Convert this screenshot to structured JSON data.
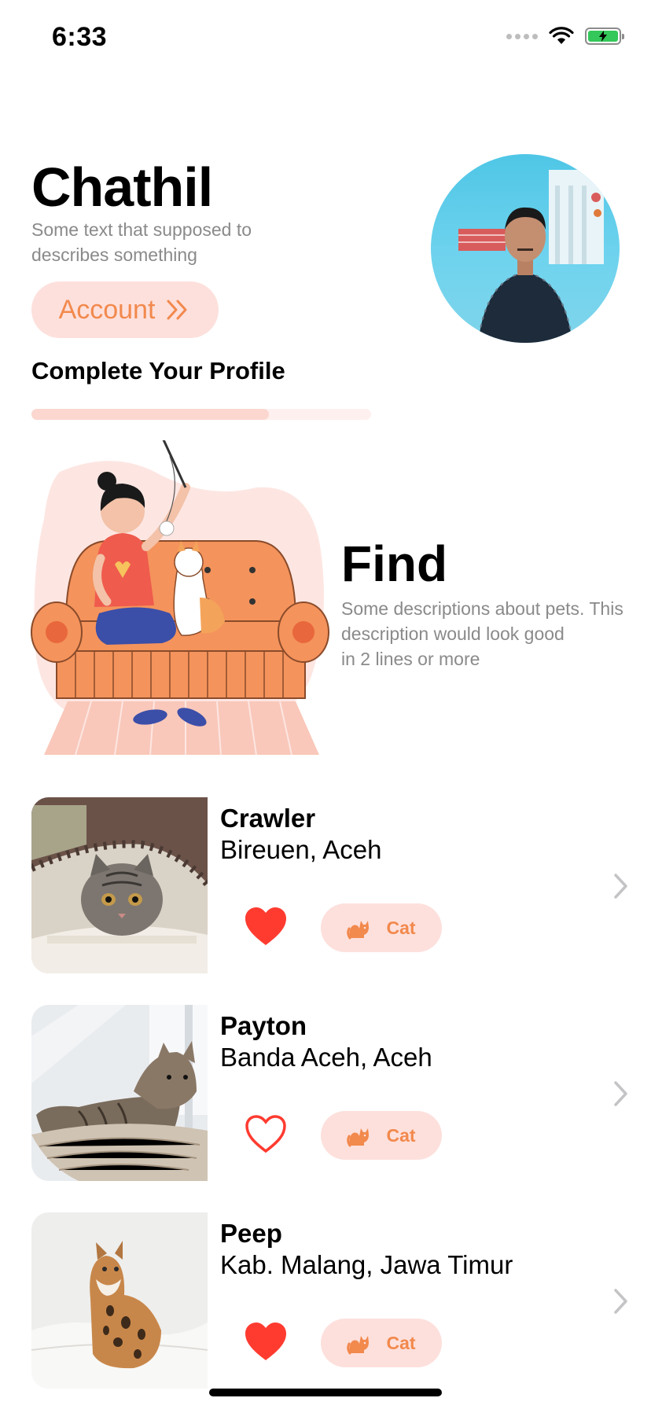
{
  "status_bar": {
    "time": "6:33"
  },
  "header": {
    "name": "Chathil",
    "subtitle": "Some text that supposed to describes something",
    "account_label": "Account"
  },
  "profile": {
    "title": "Complete Your Profile",
    "progress": 0.7
  },
  "find": {
    "title": "Find",
    "description": "Some descriptions about pets. This description would look good\nin 2 lines or more"
  },
  "pets": [
    {
      "name": "Crawler",
      "location": "Bireuen, Aceh",
      "favorite": true,
      "type": "Cat"
    },
    {
      "name": "Payton",
      "location": "Banda Aceh, Aceh",
      "favorite": false,
      "type": "Cat"
    },
    {
      "name": "Peep",
      "location": "Kab. Malang, Jawa Timur",
      "favorite": true,
      "type": "Cat"
    }
  ],
  "colors": {
    "accent": "#F2894D",
    "accent_soft": "#FDE0DC",
    "heart": "#FF3B30",
    "muted_text": "#8A8A8A"
  }
}
